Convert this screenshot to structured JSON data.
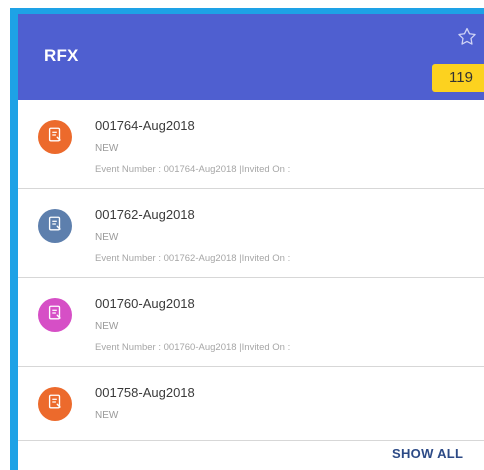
{
  "header": {
    "title": "RFX",
    "badge_count": "119",
    "star_icon": "star-outline-icon"
  },
  "colors": {
    "header_bg": "#4f5fd0",
    "frame": "#1ea2e6",
    "badge": "#fcd21f"
  },
  "items": [
    {
      "title": "001764-Aug2018",
      "status": "NEW",
      "detail": "Event Number : 001764-Aug2018 |Invited On :",
      "icon": "document-icon",
      "color": "#ec6a2c"
    },
    {
      "title": "001762-Aug2018",
      "status": "NEW",
      "detail": "Event Number : 001762-Aug2018 |Invited On :",
      "icon": "document-icon",
      "color": "#5d7fad"
    },
    {
      "title": "001760-Aug2018",
      "status": "NEW",
      "detail": "Event Number : 001760-Aug2018 |Invited On :",
      "icon": "document-icon",
      "color": "#d64fc6"
    },
    {
      "title": "001758-Aug2018",
      "status": "NEW",
      "detail": "",
      "icon": "document-icon",
      "color": "#ec6a2c"
    }
  ],
  "footer": {
    "show_all_label": "SHOW ALL"
  }
}
